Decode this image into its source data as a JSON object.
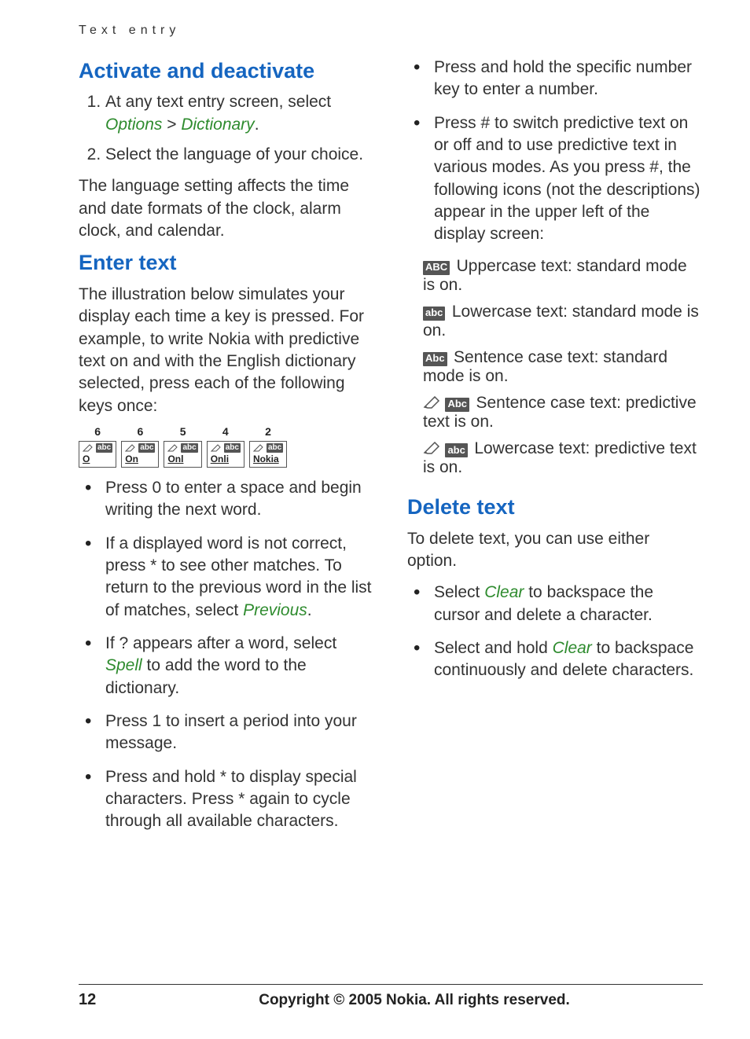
{
  "header": "Text entry",
  "left": {
    "section1": {
      "title": "Activate and deactivate",
      "steps": [
        {
          "pre": "At any text entry screen, select ",
          "kw1": "Options",
          "sep": " > ",
          "kw2": "Dictionary",
          "post": "."
        },
        {
          "text": "Select the language of your choice."
        }
      ],
      "after": "The language setting affects the time and date formats of the clock, alarm clock, and calendar."
    },
    "section2": {
      "title": "Enter text",
      "intro": "The illustration below simulates your display each time a key is pressed. For example, to write Nokia with predictive text on and with the English dictionary selected, press each of the following keys once:",
      "keysteps": [
        {
          "num": "6",
          "word": "O"
        },
        {
          "num": "6",
          "word": "On"
        },
        {
          "num": "5",
          "word": "Onl"
        },
        {
          "num": "4",
          "word": "Onli"
        },
        {
          "num": "2",
          "word": "Nokia"
        }
      ],
      "badge_small": "abc",
      "bullets1": [
        "Press 0 to enter a space and begin writing the next word.",
        {
          "pre": "If a displayed word is not correct, press * to see other matches. To return to the previous word in the list of matches, select ",
          "kw": "Previous",
          "post": "."
        },
        {
          "pre": "If ? appears after a word, select ",
          "kw": "Spell",
          "post": " to add the word to the dictionary."
        },
        "Press 1 to insert a period into your message.",
        "Press and hold * to display special characters. Press * again to cycle through all available characters."
      ]
    }
  },
  "right": {
    "bullets_top": [
      "Press and hold the specific number key to enter a number.",
      "Press # to switch predictive text on or off and to use predictive text in various modes. As you press #, the following icons (not the descriptions) appear in the upper left of the display screen:"
    ],
    "modes": [
      {
        "pen": false,
        "badge": "ABC",
        "text": "Uppercase text: standard mode is on."
      },
      {
        "pen": false,
        "badge": "abc",
        "text": "Lowercase text: standard mode is on."
      },
      {
        "pen": false,
        "badge": "Abc",
        "text": "Sentence case text: standard mode is on."
      },
      {
        "pen": true,
        "badge": "Abc",
        "text": "Sentence case text: predictive text is on."
      },
      {
        "pen": true,
        "badge": "abc",
        "text": "Lowercase text: predictive text is on."
      }
    ],
    "section3": {
      "title": "Delete text",
      "intro": "To delete text, you can use either option.",
      "bullets": [
        {
          "pre": "Select ",
          "kw": "Clear",
          "post": " to backspace the cursor and delete a character."
        },
        {
          "pre": "Select and hold ",
          "kw": "Clear",
          "post": " to backspace continuously and delete characters."
        }
      ]
    }
  },
  "footer": {
    "page": "12",
    "copyright": "Copyright © 2005 Nokia. All rights reserved."
  }
}
